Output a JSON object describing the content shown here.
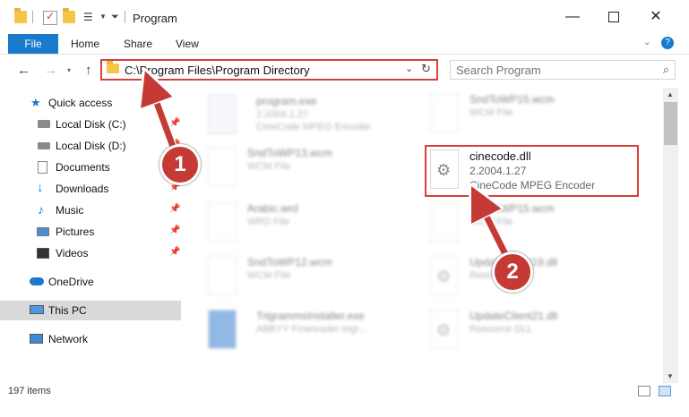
{
  "window": {
    "title": "Program",
    "minimize_icon": "minimize-icon",
    "maximize_icon": "maximize-icon",
    "close_icon": "close-icon"
  },
  "ribbon": {
    "tabs": [
      "File",
      "Home",
      "Share",
      "View"
    ],
    "help": "?"
  },
  "address": {
    "path": "C:\\Program Files\\Program Directory",
    "search_placeholder": "Search Program"
  },
  "nav": {
    "items": [
      {
        "label": "Quick access",
        "icon": "star-icon"
      },
      {
        "label": "Local Disk (C:)",
        "icon": "drive-icon"
      },
      {
        "label": "Local Disk (D:)",
        "icon": "drive-icon"
      },
      {
        "label": "Documents",
        "icon": "documents-icon"
      },
      {
        "label": "Downloads",
        "icon": "download-icon"
      },
      {
        "label": "Music",
        "icon": "music-icon"
      },
      {
        "label": "Pictures",
        "icon": "pictures-icon"
      },
      {
        "label": "Videos",
        "icon": "videos-icon"
      },
      {
        "label": "OneDrive",
        "icon": "cloud-icon"
      },
      {
        "label": "This PC",
        "icon": "computer-icon"
      },
      {
        "label": "Network",
        "icon": "network-icon"
      }
    ]
  },
  "files": [
    {
      "name": "program.exe",
      "line1": "2.2004.1.27",
      "line2": "CineCode MPEG Encoder"
    },
    {
      "name": "SndToWP15.wcm",
      "line1": "WCM File",
      "line2": ""
    },
    {
      "name": "SndToWP13.wcm",
      "line1": "WCM File",
      "line2": ""
    },
    {
      "name": "cinecode.dll",
      "line1": "2.2004.1.27",
      "line2": "CineCode MPEG Encoder"
    },
    {
      "name": "Arabic.wrd",
      "line1": "WRD File",
      "line2": ""
    },
    {
      "name": "SndToWP15.wcm",
      "line1": "WCM File",
      "line2": ""
    },
    {
      "name": "SndToWP12.wcm",
      "line1": "WCM File",
      "line2": ""
    },
    {
      "name": "UpdateClient19.dll",
      "line1": "Resource DLL",
      "line2": ""
    },
    {
      "name": "TrigrammsInstaller.exe",
      "line1": "ABBYY Finereader trigr...",
      "line2": ""
    },
    {
      "name": "UpdateClient21.dll",
      "line1": "Resource DLL",
      "line2": ""
    }
  ],
  "status": {
    "count": "197 items"
  },
  "callouts": {
    "one": "1",
    "two": "2"
  },
  "colors": {
    "accent": "#1979ca",
    "highlight": "#d9403a",
    "badge": "#c53a35"
  }
}
